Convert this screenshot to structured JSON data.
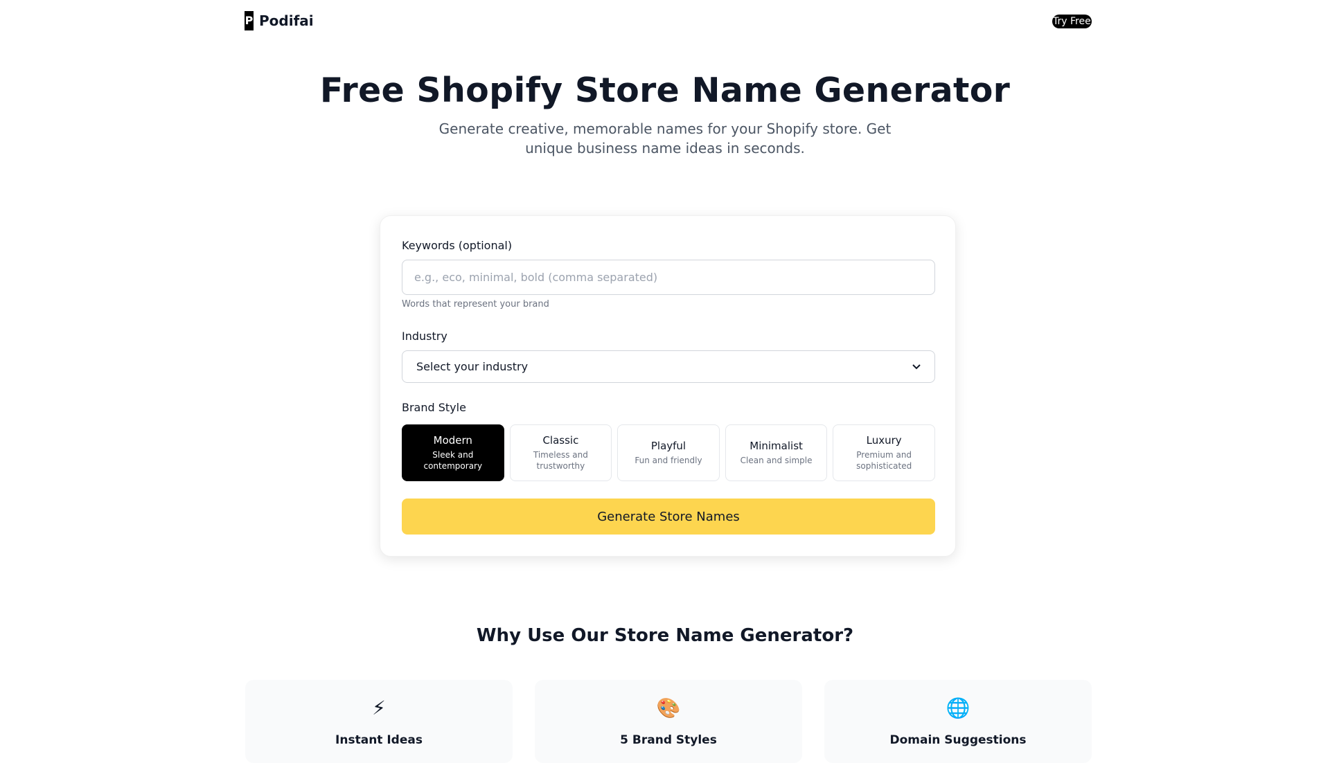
{
  "header": {
    "logo_mark": "P",
    "logo_text": "Podifai",
    "try_free_label": "Try Free"
  },
  "hero": {
    "title": "Free Shopify Store Name Generator",
    "subtitle": "Generate creative, memorable names for your Shopify store. Get unique business name ideas in seconds."
  },
  "form": {
    "keywords_label": "Keywords (optional)",
    "keywords_placeholder": "e.g., eco, minimal, bold (comma separated)",
    "keywords_value": "",
    "keywords_help": "Words that represent your brand",
    "industry_label": "Industry",
    "industry_selected": "Select your industry",
    "brand_style_label": "Brand Style",
    "styles": [
      {
        "name": "Modern",
        "desc": "Sleek and contemporary",
        "active": true
      },
      {
        "name": "Classic",
        "desc": "Timeless and trustworthy",
        "active": false
      },
      {
        "name": "Playful",
        "desc": "Fun and friendly",
        "active": false
      },
      {
        "name": "Minimalist",
        "desc": "Clean and simple",
        "active": false
      },
      {
        "name": "Luxury",
        "desc": "Premium and sophisticated",
        "active": false
      }
    ],
    "generate_label": "Generate Store Names"
  },
  "why": {
    "title": "Why Use Our Store Name Generator?",
    "features": [
      {
        "icon": "lightning-icon",
        "glyph": "⚡",
        "title": "Instant Ideas"
      },
      {
        "icon": "palette-icon",
        "glyph": "🎨",
        "title": "5 Brand Styles"
      },
      {
        "icon": "globe-icon",
        "glyph": "🌐",
        "title": "Domain Suggestions"
      }
    ]
  },
  "colors": {
    "accent_yellow": "#fdd54f",
    "active_style_bg": "#000000"
  }
}
